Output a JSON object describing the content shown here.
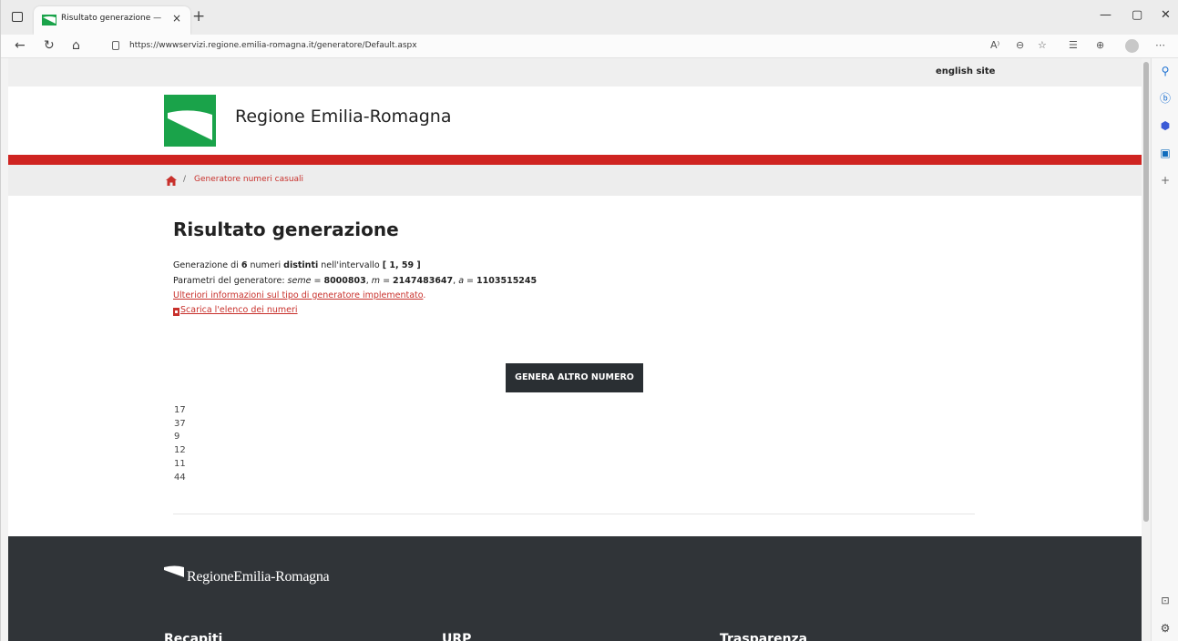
{
  "browser": {
    "tab_title": "Risultato generazione — E-R Il p",
    "tab_close": "×",
    "new_tab": "+",
    "url": "https://wwwservizi.regione.emilia-romagna.it/generatore/Default.aspx",
    "read_aloud": "A⁾",
    "window_minimize": "—",
    "window_maximize": "▢",
    "window_close": "✕"
  },
  "site": {
    "english_link": "english site",
    "region_title": "Regione Emilia-Romagna",
    "breadcrumb_separator": "/",
    "breadcrumb_current": "Generatore numeri casuali",
    "footer_logo": "RegioneEmilia-Romagna",
    "footer_columns": [
      "Recapiti",
      "URP",
      "Trasparenza"
    ]
  },
  "result": {
    "heading": "Risultato generazione",
    "line1_prefix": "Generazione di ",
    "count": "6",
    "line1_mid": " numeri ",
    "distinct": "distinti",
    "line1_range_label": " nell'intervallo ",
    "range": "[ 1, 59 ]",
    "line2_prefix": "Parametri del generatore: ",
    "seme_label": "seme",
    "seme_value": "8000803",
    "m_label": "m",
    "m_value": "2147483647",
    "a_label": "a",
    "a_value": "1103515245",
    "eq": " = ",
    "comma": ", ",
    "info_link": "Ulteriori informazioni sul tipo di generatore implementato",
    "info_link_end": ".",
    "download_link": "Scarica l'elenco dei numeri",
    "button": "GENERA ALTRO NUMERO",
    "numbers": [
      "17",
      "37",
      "9",
      "12",
      "11",
      "44"
    ]
  },
  "colors": {
    "brand_red": "#cf2421",
    "brand_green": "#1aa34a",
    "footer_bg": "#303438"
  }
}
